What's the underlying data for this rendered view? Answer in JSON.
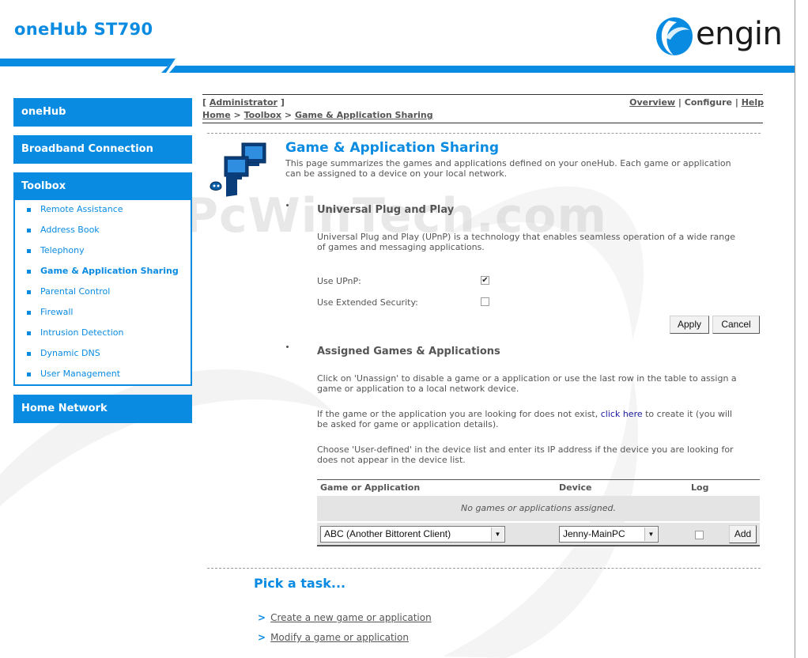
{
  "app": {
    "title": "oneHub ST790",
    "brand": "engin",
    "brand_reg": "®"
  },
  "watermark": "PcWinTech.com",
  "colors": {
    "accent": "#0a8be2",
    "text": "#555555",
    "row_bg": "#e4e4e4"
  },
  "sidebar": {
    "tabs": [
      "oneHub",
      "Broadband Connection",
      "Toolbox",
      "Home Network"
    ],
    "toolbox_items": [
      "Remote Assistance",
      "Address Book",
      "Telephony",
      "Game & Application Sharing",
      "Parental Control",
      "Firewall",
      "Intrusion Detection",
      "Dynamic DNS",
      "User Management"
    ],
    "active_item": "Game & Application Sharing"
  },
  "header": {
    "user_prefix": "[ ",
    "user": "Administrator",
    "user_suffix": " ]",
    "breadcrumb": [
      "Home",
      "Toolbox",
      "Game & Application Sharing"
    ],
    "breadcrumb_sep": " > ",
    "nav": [
      "Overview",
      "Configure",
      "Help"
    ],
    "nav_sep": " | "
  },
  "page": {
    "title": "Game & Application Sharing",
    "intro_1": "This page summarizes the games and applications defined on your oneHub. Each game or application",
    "intro_2": "can be assigned to a device on your local network."
  },
  "upnp": {
    "heading": "Universal Plug and Play",
    "desc_1": "Universal Plug and Play (UPnP) is a technology that enables seamless operation of a wide range",
    "desc_2": "of games and messaging applications.",
    "use_upnp_label": "Use UPnP:",
    "use_upnp_checked": true,
    "ext_security_label": "Use Extended Security:",
    "ext_security_checked": false,
    "apply": "Apply",
    "cancel": "Cancel",
    "check_glyph": "✔"
  },
  "assigned": {
    "heading": "Assigned Games & Applications",
    "p1_1": "Click on 'Unassign' to disable a game or a application or use the last row in the table to assign a",
    "p1_2": "game or application to a local network device.",
    "p2_a": "If the game or the application you are looking for does not exist, ",
    "p2_link": "click here",
    "p2_b": " to create it (you will",
    "p2_2": "be asked for game or application details).",
    "p3_1": "Choose 'User-defined' in the device list and enter its IP address if the device you are looking for",
    "p3_2": "does not appear in the device list.",
    "columns": [
      "Game or Application",
      "Device",
      "Log"
    ],
    "empty_text": "No games or applications assigned.",
    "game_select": "ABC (Another Bittorent Client)",
    "device_select": "Jenny-MainPC",
    "add": "Add"
  },
  "tasks": {
    "heading": "Pick a task...",
    "items": [
      "Create a new game or application",
      "Modify a game or application"
    ]
  }
}
